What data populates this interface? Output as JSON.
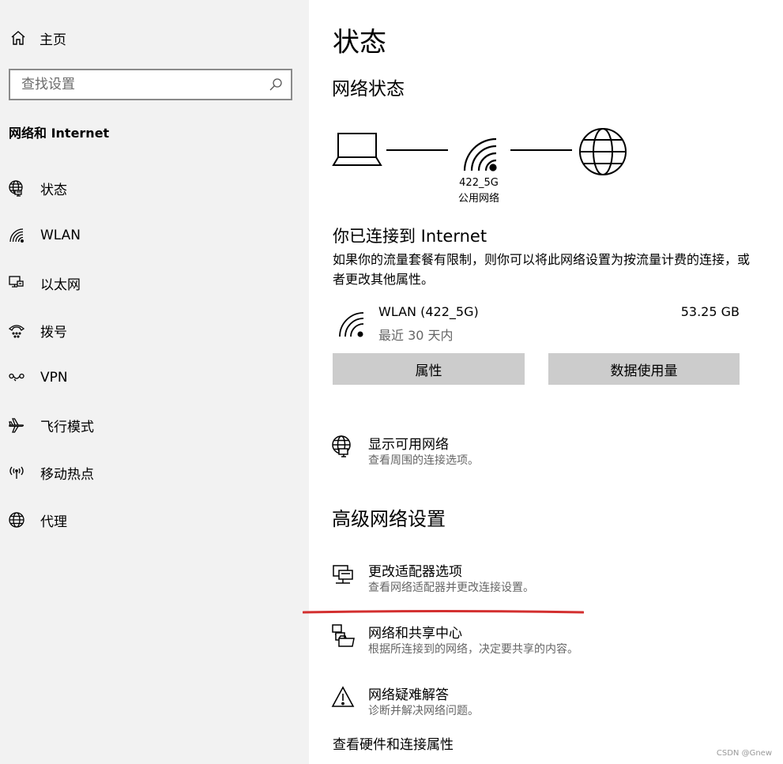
{
  "sidebar": {
    "home_label": "主页",
    "search_placeholder": "查找设置",
    "section_title": "网络和 Internet",
    "items": [
      {
        "label": "状态",
        "icon": "globe-status-icon"
      },
      {
        "label": "WLAN",
        "icon": "wifi-icon"
      },
      {
        "label": "以太网",
        "icon": "ethernet-icon"
      },
      {
        "label": "拨号",
        "icon": "dialup-icon"
      },
      {
        "label": "VPN",
        "icon": "vpn-icon"
      },
      {
        "label": "飞行模式",
        "icon": "airplane-icon"
      },
      {
        "label": "移动热点",
        "icon": "hotspot-icon"
      },
      {
        "label": "代理",
        "icon": "globe-icon"
      }
    ]
  },
  "main": {
    "title": "状态",
    "network_status_title": "网络状态",
    "diagram": {
      "network_name": "422_5G",
      "network_type": "公用网络"
    },
    "connected_title": "你已连接到 Internet",
    "connected_desc": "如果你的流量套餐有限制，则你可以将此网络设置为按流量计费的连接，或者更改其他属性。",
    "connection": {
      "name": "WLAN (422_5G)",
      "period": "最近 30 天内",
      "usage": "53.25 GB"
    },
    "buttons": {
      "properties": "属性",
      "data_usage": "数据使用量"
    },
    "show_networks": {
      "title": "显示可用网络",
      "desc": "查看周围的连接选项。"
    },
    "advanced_title": "高级网络设置",
    "advanced_links": [
      {
        "title": "更改适配器选项",
        "desc": "查看网络适配器并更改连接设置。"
      },
      {
        "title": "网络和共享中心",
        "desc": "根据所连接到的网络，决定要共享的内容。"
      },
      {
        "title": "网络疑难解答",
        "desc": "诊断并解决网络问题。"
      }
    ],
    "hardware_link": "查看硬件和连接属性"
  },
  "annotation": {
    "underline_color": "#d32f2f"
  },
  "watermark": "CSDN @Gnew"
}
